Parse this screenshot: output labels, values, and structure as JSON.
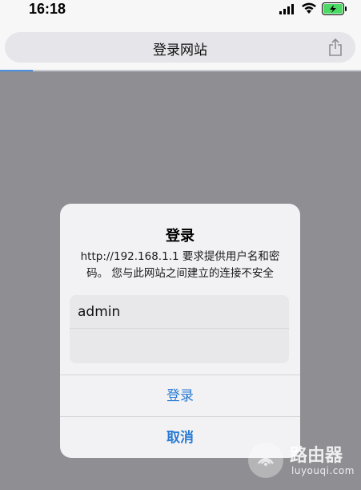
{
  "status": {
    "time": "16:18"
  },
  "browser": {
    "title": "登录网站",
    "progress": 0.09
  },
  "dialog": {
    "title": "登录",
    "message": "http://192.168.1.1 要求提供用户名和密码。 您与此网站之间建立的连接不安全",
    "username_value": "admin",
    "password_value": "",
    "login_label": "登录",
    "cancel_label": "取消"
  },
  "watermark": {
    "text": "路由器",
    "sub": "luyouqi.com"
  },
  "colors": {
    "accent": "#2a7bd5",
    "overlay": "#8e8e93",
    "battery": "#4cd964"
  }
}
